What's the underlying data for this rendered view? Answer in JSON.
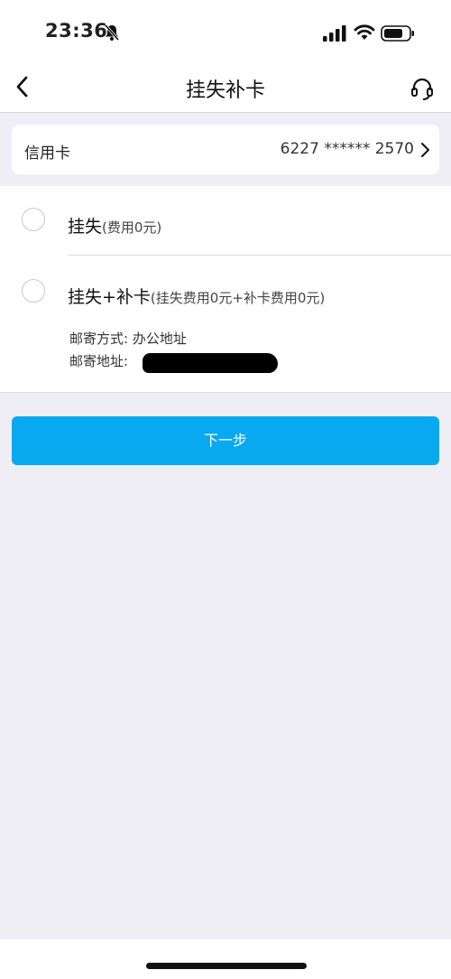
{
  "status_bar": {
    "time": "23:36",
    "icons": [
      "bell-slash-icon",
      "signal-icon",
      "wifi-icon",
      "battery-icon"
    ]
  },
  "nav": {
    "title": "挂失补卡",
    "back_icon": "chevron-left-icon",
    "support_icon": "headset-icon"
  },
  "card": {
    "type_label": "信用卡",
    "number": "6227 ****** 2570",
    "chevron_icon": "chevron-right-icon"
  },
  "options": [
    {
      "label": "挂失",
      "fee_note": "(费用0元)",
      "selected": false
    },
    {
      "label": "挂失+补卡",
      "fee_note": "(挂失费用0元+补卡费用0元)",
      "selected": false
    }
  ],
  "mailing": {
    "method_label": "邮寄方式:",
    "method_value": "办公地址",
    "address_label": "邮寄地址:"
  },
  "actions": {
    "next_label": "下一步"
  },
  "colors": {
    "accent": "#08a9ee",
    "background": "#efeef5"
  }
}
